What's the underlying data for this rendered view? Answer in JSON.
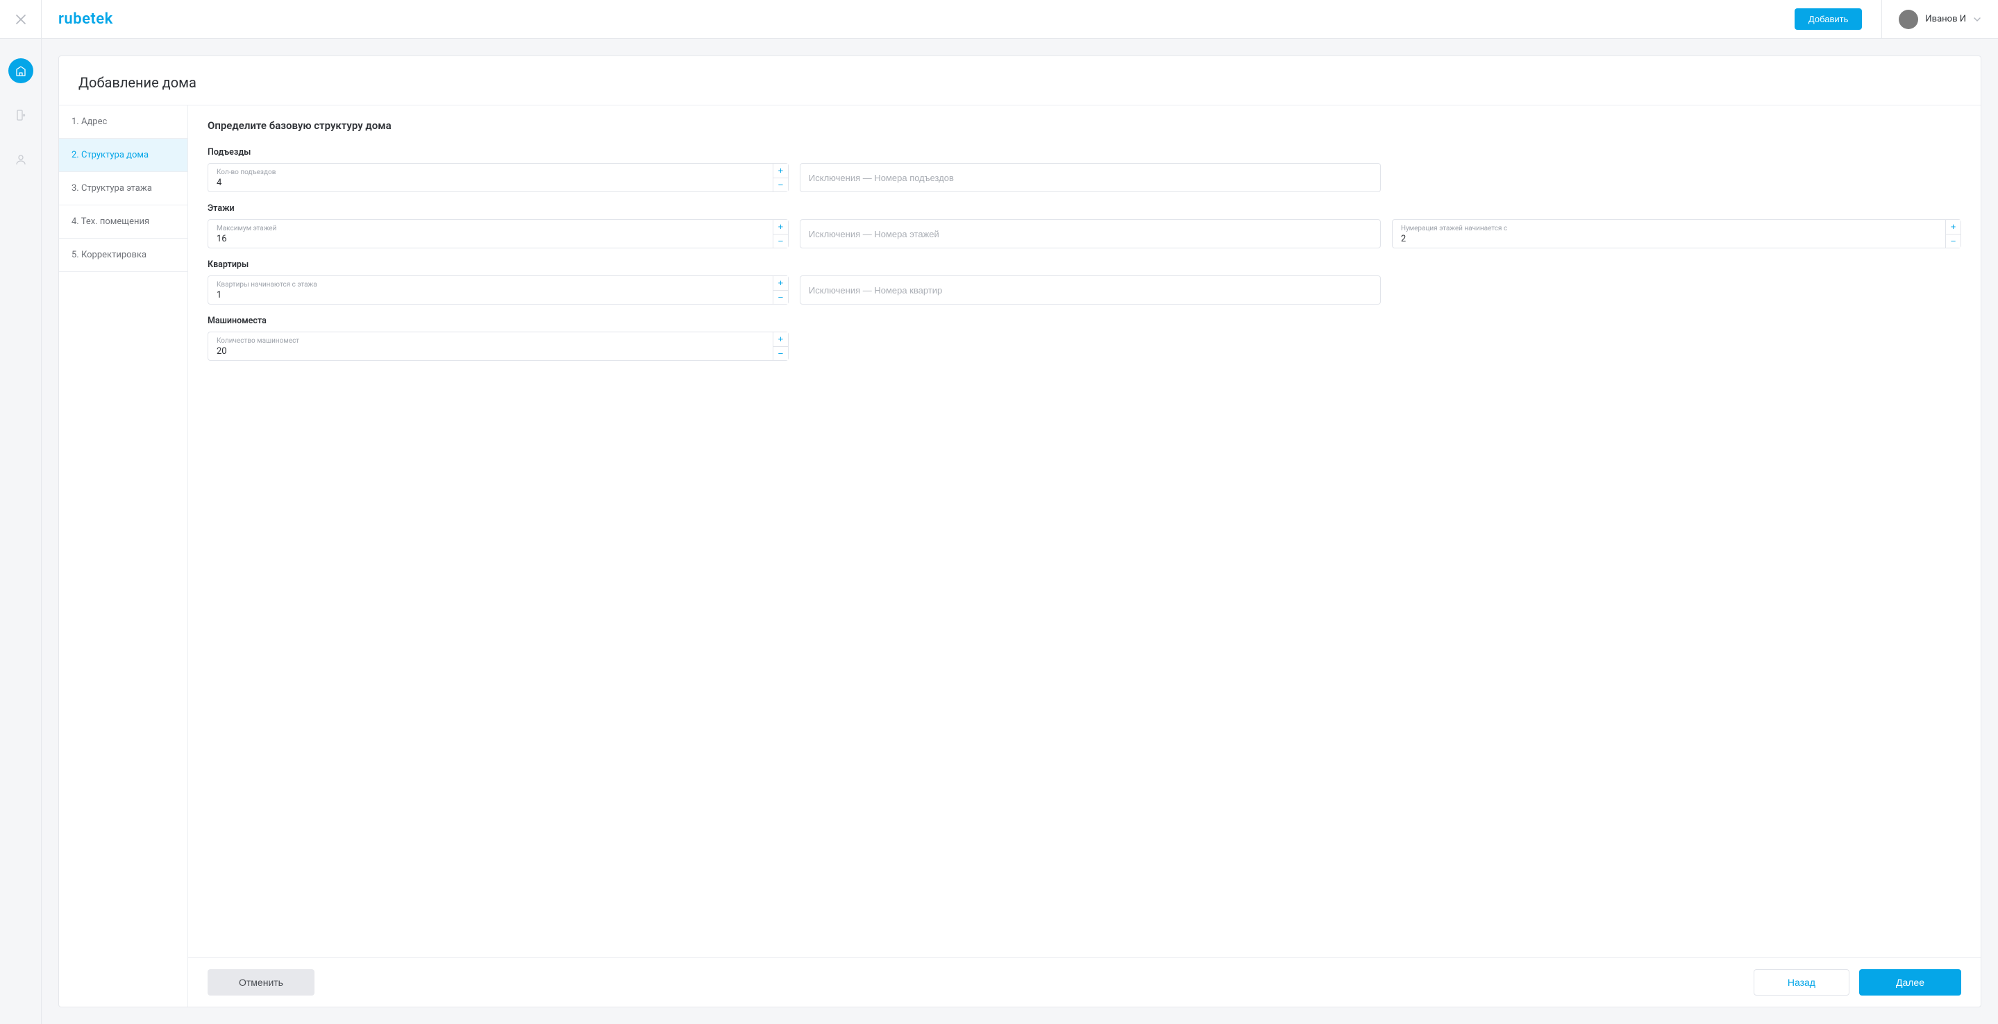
{
  "brand": "rubetek",
  "header": {
    "add_button": "Добавить",
    "user_name": "Иванов И"
  },
  "nav": {
    "items": [
      {
        "icon": "building-icon",
        "active": true
      },
      {
        "icon": "device-icon",
        "active": false
      },
      {
        "icon": "user-icon",
        "active": false
      }
    ]
  },
  "page": {
    "title": "Добавление дома"
  },
  "steps": [
    {
      "label": "1. Адрес",
      "active": false
    },
    {
      "label": "2. Структура дома",
      "active": true
    },
    {
      "label": "3. Структура этажа",
      "active": false
    },
    {
      "label": "4. Тех. помещения",
      "active": false
    },
    {
      "label": "5. Корректировка",
      "active": false
    }
  ],
  "form": {
    "heading": "Определите базовую структуру дома",
    "sections": {
      "entrances": {
        "title": "Подъезды",
        "count_label": "Кол-во подъездов",
        "count_value": "4",
        "exclusion_placeholder": "Исключения — Номера подъездов"
      },
      "floors": {
        "title": "Этажи",
        "max_label": "Максимум этажей",
        "max_value": "16",
        "exclusion_placeholder": "Исключения — Номера этажей",
        "numbering_label": "Нумерация этажей начинается с",
        "numbering_value": "2"
      },
      "apartments": {
        "title": "Квартиры",
        "start_label": "Квартиры начинаются с этажа",
        "start_value": "1",
        "exclusion_placeholder": "Исключения — Номера квартир"
      },
      "parking": {
        "title": "Машиноместа",
        "count_label": "Количество машиномест",
        "count_value": "20"
      }
    }
  },
  "footer": {
    "cancel": "Отменить",
    "back": "Назад",
    "next": "Далее"
  },
  "colors": {
    "accent": "#05A6E8",
    "border": "#e6e8ec",
    "bg": "#f5f6f8"
  }
}
